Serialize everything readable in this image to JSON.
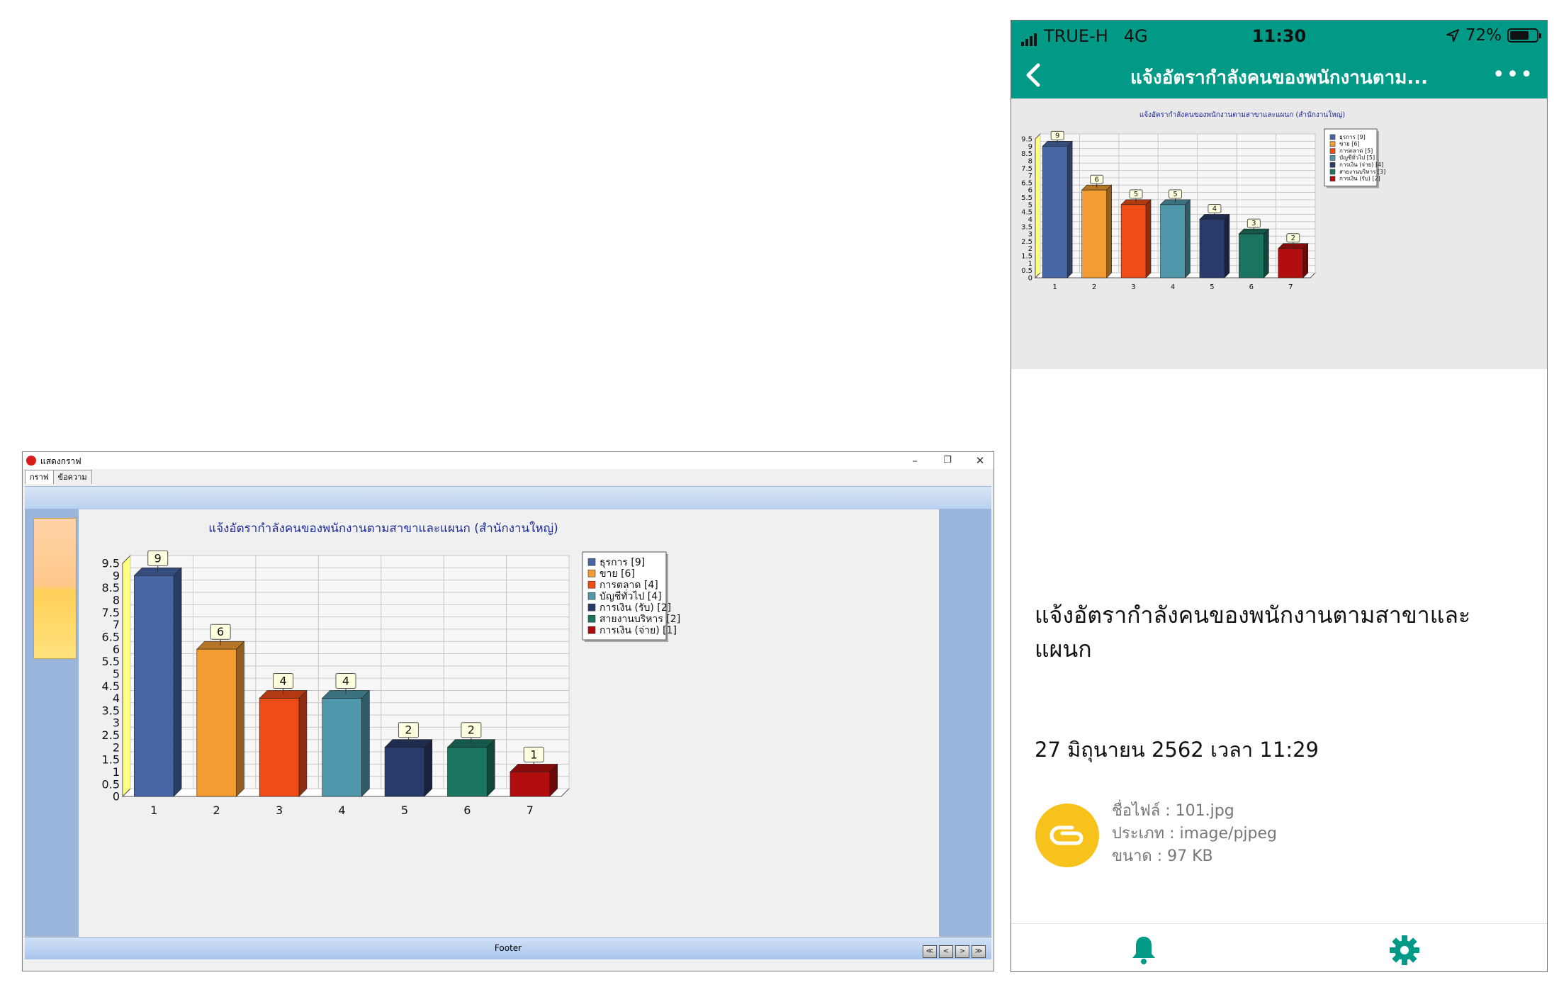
{
  "window": {
    "title": "แสดงกราฟ",
    "tabs": [
      "กราฟ",
      "ข้อความ"
    ],
    "controls": {
      "minimize": "–",
      "restore": "❐",
      "close": "✕"
    },
    "footer": "Footer",
    "nav_buttons": [
      "≪",
      "<",
      ">",
      "≫"
    ]
  },
  "phone": {
    "carrier": "TRUE-H",
    "network": "4G",
    "time": "11:30",
    "battery": "72%",
    "battery_level": 0.72,
    "header_title": "แจ้งอัตรากำลังคนของพนักงานตาม...",
    "message_title": "แจ้งอัตรากำลังคนของพนักงานตามสาขาและแผนก",
    "date": "27 มิถุนายน 2562 เวลา 11:29",
    "file_name": "ชื่อไฟล์ : 101.jpg",
    "file_type": "ประเภท : image/pjpeg",
    "file_size": "ขนาด : 97 KB",
    "icons": {
      "back": "chevron-left-icon",
      "more": "more-dots-icon",
      "attachment": "paperclip-icon",
      "bell": "bell-icon",
      "settings": "gear-icon"
    },
    "accent": "#009a86"
  },
  "chart_data": [
    {
      "type": "bar",
      "title": "แจ้งอัตรากำลังคนของพนักงานตามสาขาและแผนก (สำนักงานใหญ่)",
      "categories": [
        "1",
        "2",
        "3",
        "4",
        "5",
        "6",
        "7"
      ],
      "values": [
        9,
        6,
        4,
        4,
        2,
        2,
        1
      ],
      "colors": [
        "#4666a6",
        "#f39c33",
        "#ef4c17",
        "#4f98ab",
        "#293b6a",
        "#1c7561",
        "#b30e0f"
      ],
      "legend": [
        "ธุรการ [9]",
        "ขาย [6]",
        "การตลาด [4]",
        "บัญชีทั่วไป [4]",
        "การเงิน (รับ) [2]",
        "สายงานบริหาร [2]",
        "การเงิน (จ่าย) [1]"
      ],
      "legend_position": "right",
      "ylim": [
        0,
        9.5
      ],
      "ytick_step": 0.5,
      "grid": true
    },
    {
      "type": "bar",
      "title": "แจ้งอัตรากำลังคนของพนักงานตามสาขาและแผนก (สำนักงานใหญ่)",
      "categories": [
        "1",
        "2",
        "3",
        "4",
        "5",
        "6",
        "7"
      ],
      "values": [
        9,
        6,
        5,
        5,
        4,
        3,
        2
      ],
      "colors": [
        "#4666a6",
        "#f39c33",
        "#ef4c17",
        "#4f98ab",
        "#293b6a",
        "#1c7561",
        "#b30e0f"
      ],
      "legend": [
        "ธุรการ [9]",
        "ขาย [6]",
        "การตลาด [5]",
        "บัญชีทั่วไป [5]",
        "การเงิน (จ่าย) [4]",
        "สายงานบริหาร [3]",
        "การเงิน (รับ) [2]"
      ],
      "legend_position": "right",
      "ylim": [
        0,
        9.5
      ],
      "ytick_step": 0.5,
      "grid": true
    }
  ]
}
